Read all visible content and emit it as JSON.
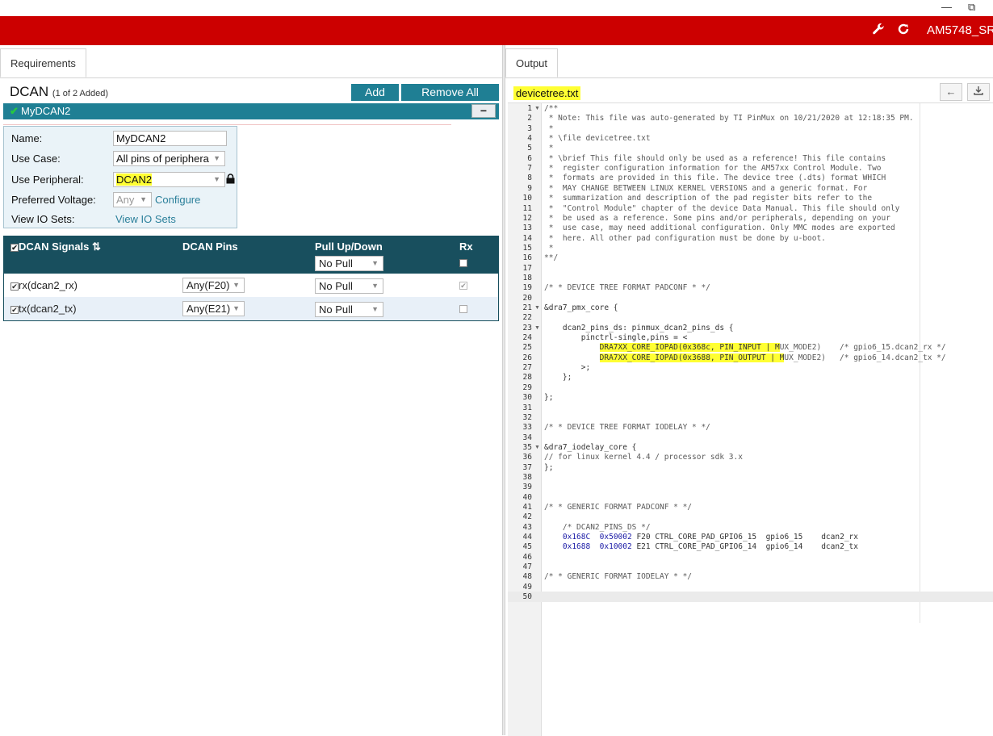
{
  "window": {
    "restore_glyph": "⧉"
  },
  "header": {
    "device": "AM5748_SR"
  },
  "requirements": {
    "tab_label": "Requirements",
    "peripheral": "DCAN",
    "added_count": "(1 of 2 Added)",
    "add_label": "Add",
    "remove_all_label": "Remove All",
    "instance": {
      "name": "MyDCAN2",
      "minus": "−"
    },
    "config": {
      "name_label": "Name:",
      "name_value": "MyDCAN2",
      "use_case_label": "Use Case:",
      "use_case_value": "All pins of periphera",
      "use_peripheral_label": "Use Peripheral:",
      "use_peripheral_value": "DCAN2",
      "preferred_voltage_label": "Preferred Voltage:",
      "preferred_voltage_value": "Any",
      "configure_link": "Configure",
      "view_io_sets_label": "View IO Sets:",
      "view_io_sets_link": "View IO Sets"
    },
    "signals": {
      "headers": {
        "signal": "DCAN Signals",
        "pins": "DCAN Pins",
        "pull": "Pull Up/Down",
        "rx": "Rx"
      },
      "pull_all_value": "No Pull",
      "rows": [
        {
          "signal": "rx(dcan2_rx)",
          "pin": "Any(F20)",
          "pull": "No Pull",
          "rx_checked": true
        },
        {
          "signal": "tx(dcan2_tx)",
          "pin": "Any(E21)",
          "pull": "No Pull",
          "rx_checked": false
        }
      ]
    }
  },
  "output": {
    "tab_label": "Output",
    "filename": "devicetree.txt",
    "lines": [
      {
        "n": "1",
        "fold": true,
        "text": "/**",
        "style": "comment"
      },
      {
        "n": "2",
        "text": " * Note: This file was auto-generated by TI PinMux on 10/21/2020 at 12:18:35 PM.",
        "style": "comment"
      },
      {
        "n": "3",
        "text": " *",
        "style": "comment"
      },
      {
        "n": "4",
        "text": " * \\file devicetree.txt",
        "style": "comment"
      },
      {
        "n": "5",
        "text": " *",
        "style": "comment"
      },
      {
        "n": "6",
        "text": " * \\brief This file should only be used as a reference! This file contains",
        "style": "comment"
      },
      {
        "n": "7",
        "text": " *  register configuration information for the AM57xx Control Module. Two",
        "style": "comment"
      },
      {
        "n": "8",
        "text": " *  formats are provided in this file. The device tree (.dts) format WHICH",
        "style": "comment"
      },
      {
        "n": "9",
        "text": " *  MAY CHANGE BETWEEN LINUX KERNEL VERSIONS and a generic format. For",
        "style": "comment"
      },
      {
        "n": "10",
        "text": " *  summarization and description of the pad register bits refer to the",
        "style": "comment"
      },
      {
        "n": "11",
        "text": " *  \"Control Module\" chapter of the device Data Manual. This file should only",
        "style": "comment"
      },
      {
        "n": "12",
        "text": " *  be used as a reference. Some pins and/or peripherals, depending on your",
        "style": "comment"
      },
      {
        "n": "13",
        "text": " *  use case, may need additional configuration. Only MMC modes are exported",
        "style": "comment"
      },
      {
        "n": "14",
        "text": " *  here. All other pad configuration must be done by u-boot.",
        "style": "comment"
      },
      {
        "n": "15",
        "text": " *",
        "style": "comment"
      },
      {
        "n": "16",
        "text": "**/",
        "style": "comment"
      },
      {
        "n": "17",
        "text": "",
        "style": "plain"
      },
      {
        "n": "18",
        "text": "",
        "style": "plain"
      },
      {
        "n": "19",
        "text": "/* * DEVICE TREE FORMAT PADCONF * */",
        "style": "comment"
      },
      {
        "n": "20",
        "text": "",
        "style": "plain"
      },
      {
        "n": "21",
        "fold": true,
        "text": "&dra7_pmx_core {",
        "style": "plain"
      },
      {
        "n": "22",
        "text": "",
        "style": "plain"
      },
      {
        "n": "23",
        "fold": true,
        "text": "    dcan2_pins_ds: pinmux_dcan2_pins_ds {",
        "style": "plain"
      },
      {
        "n": "24",
        "text": "        pinctrl-single,pins = <",
        "style": "plain"
      },
      {
        "n": "25",
        "text": "            DRA7XX_CORE_IOPAD(0x368c, PIN_INPUT | MUX_MODE2)    /* gpio6_15.dcan2_rx */",
        "style": "plain",
        "hl_len": 51
      },
      {
        "n": "26",
        "text": "            DRA7XX_CORE_IOPAD(0x3688, PIN_OUTPUT | MUX_MODE2)   /* gpio6_14.dcan2_tx */",
        "style": "plain",
        "hl_len": 52
      },
      {
        "n": "27",
        "text": "        >;",
        "style": "plain"
      },
      {
        "n": "28",
        "text": "    };",
        "style": "plain"
      },
      {
        "n": "29",
        "text": "",
        "style": "plain"
      },
      {
        "n": "30",
        "text": "};",
        "style": "plain"
      },
      {
        "n": "31",
        "text": "",
        "style": "plain"
      },
      {
        "n": "32",
        "text": "",
        "style": "plain"
      },
      {
        "n": "33",
        "text": "/* * DEVICE TREE FORMAT IODELAY * */",
        "style": "comment"
      },
      {
        "n": "34",
        "text": "",
        "style": "plain"
      },
      {
        "n": "35",
        "fold": true,
        "text": "&dra7_iodelay_core {",
        "style": "plain"
      },
      {
        "n": "36",
        "text": "// for linux kernel 4.4 / processor sdk 3.x",
        "style": "comment"
      },
      {
        "n": "37",
        "text": "};",
        "style": "plain"
      },
      {
        "n": "38",
        "text": "",
        "style": "plain"
      },
      {
        "n": "39",
        "text": "",
        "style": "plain"
      },
      {
        "n": "40",
        "text": "",
        "style": "plain"
      },
      {
        "n": "41",
        "text": "/* * GENERIC FORMAT PADCONF * */",
        "style": "comment"
      },
      {
        "n": "42",
        "text": "",
        "style": "plain"
      },
      {
        "n": "43",
        "text": "    /* DCAN2_PINS_DS */",
        "style": "comment"
      },
      {
        "n": "44",
        "text": "    0x168C  0x50002 F20 CTRL_CORE_PAD_GPIO6_15  gpio6_15    dcan2_rx",
        "style": "plain",
        "hex": true
      },
      {
        "n": "45",
        "text": "    0x1688  0x10002 E21 CTRL_CORE_PAD_GPIO6_14  gpio6_14    dcan2_tx",
        "style": "plain",
        "hex": true
      },
      {
        "n": "46",
        "text": "",
        "style": "plain"
      },
      {
        "n": "47",
        "text": "",
        "style": "plain"
      },
      {
        "n": "48",
        "text": "/* * GENERIC FORMAT IODELAY * */",
        "style": "comment"
      },
      {
        "n": "49",
        "text": "",
        "style": "plain"
      },
      {
        "n": "50",
        "text": "",
        "style": "plain"
      }
    ]
  },
  "colors": {
    "header_red": "#cc0000",
    "teal": "#1f7f94",
    "dark_teal": "#184f5e",
    "highlight": "#ffff33"
  }
}
